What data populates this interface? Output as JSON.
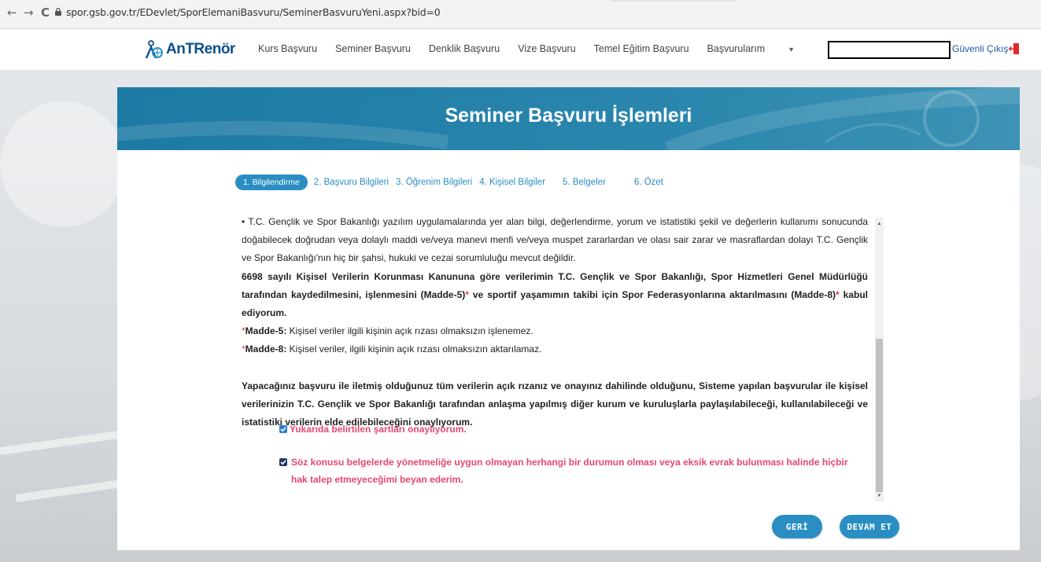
{
  "browser": {
    "back": "←",
    "forward": "→",
    "reload": "C",
    "url": "spor.gsb.gov.tr/EDevlet/SporElemaniBasvuru/SeminerBasvuruYeni.aspx?bid=0"
  },
  "header": {
    "logo": "AnTRenör",
    "menu": [
      "Kurs Başvuru",
      "Seminer Başvuru",
      "Denklik Başvuru",
      "Vize Başvuru",
      "Temel Eğitim Başvuru",
      "Başvurularım"
    ],
    "menu_caret": "▼",
    "logout": "Güvenli Çıkış"
  },
  "banner": {
    "title": "Seminer Başvuru İşlemleri"
  },
  "steps": {
    "active": "1. Bilgilendirme",
    "items": [
      "2. Başvuru Bilgileri",
      "3. Öğrenim Bilgileri",
      "4. Kişisel Bilgiler",
      "5. Belgeler",
      "6. Özet"
    ]
  },
  "content": {
    "p1": "• T.C. Gençlik ve Spor Bakanlığı yazılım uygulamalarında yer alan bilgi, değerlendirme, yorum ve istatistiki şekil ve değerlerin kullanımı sonucunda doğabilecek doğrudan veya dolaylı maddi ve/veya manevi menfi ve/veya muspet zararlardan ve olası sair zarar ve masraflardan dolayı T.C. Gençlik ve Spor Bakanlığı'nın hiç bir şahsi, hukuki ve cezai sorumluluğu mevcut değildir.",
    "p2_a": "6698 sayılı Kişisel Verilerin Korunması Kanununa göre verilerimin T.C. Gençlik ve Spor Bakanlığı, Spor Hizmetleri Genel Müdürlüğü tarafından kaydedilmesini, işlenmesini (Madde-5)",
    "p2_b": " ve sportif yaşamımın takibi için Spor Federasyonlarına aktarılmasını (Madde-8)",
    "p2_c": " kabul ediyorum.",
    "star": "*",
    "m5_label": "Madde-5:",
    "m5_text": " Kişisel veriler ilgili kişinin açık rızası olmaksızın işlenemez.",
    "m8_label": "Madde-8:",
    "m8_text": " Kişisel veriler, ilgili kişinin açık rızası olmaksızın aktarılamaz.",
    "p3": "Yapacağınız başvuru ile iletmiş olduğunuz tüm verilerin açık rızanız ve onayınız dahilinde olduğunu, Sisteme yapılan başvurular ile kişisel verilerinizin T.C. Gençlik ve Spor Bakanlığı tarafından anlaşma yapılmış diğer kurum ve kuruluşlarla paylaşılabileceği, kullanılabileceği ve istatistiki verilerin elde edilebileceğini onaylıyorum.",
    "check1": "Yukarıda belirtilen şartları onaylıyorum.",
    "check2": "Söz konusu belgelerde yönetmeliğe uygun olmayan herhangi bir durumun olması veya eksik evrak bulunması halinde hiçbir hak talep etmeyeceğimi beyan ederim."
  },
  "buttons": {
    "back": "GERİ",
    "next": "DEVAM ET"
  },
  "colors": {
    "primary": "#2a8ec2",
    "banner": "#1d7aa3",
    "check_text": "#e8476f"
  }
}
